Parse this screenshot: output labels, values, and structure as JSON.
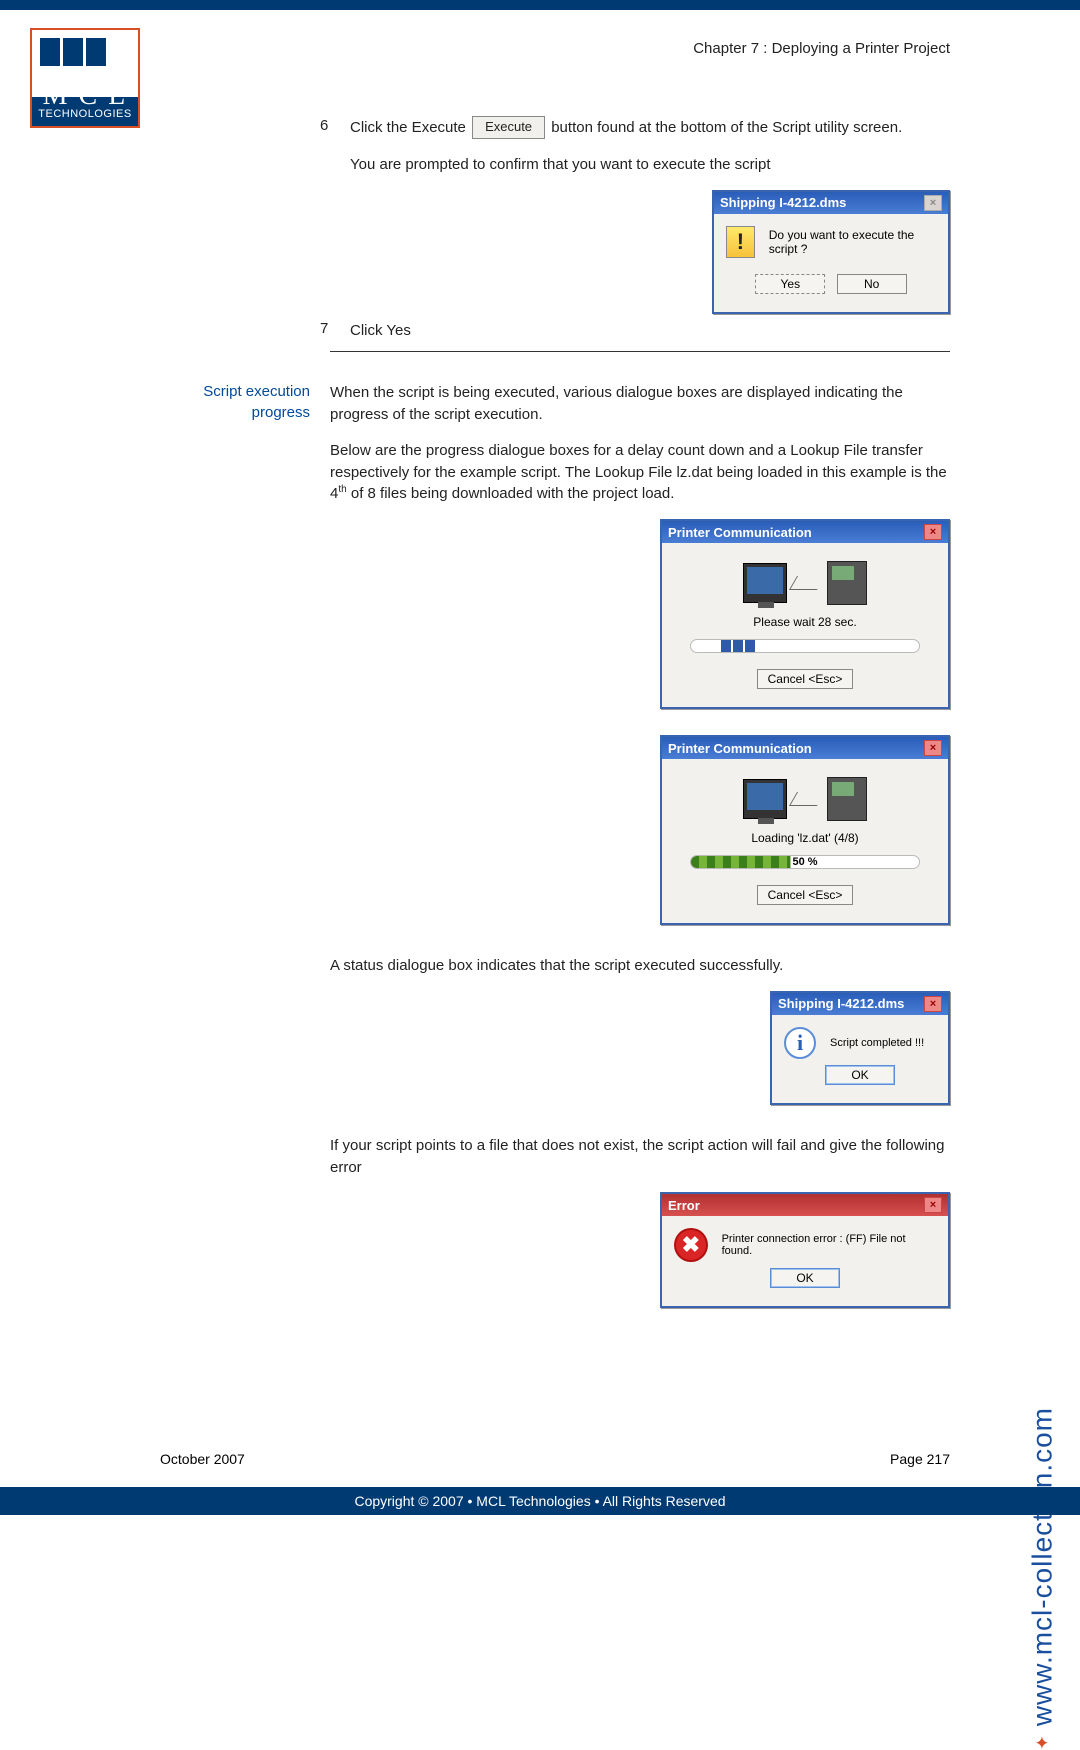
{
  "header": {
    "chapter": "Chapter 7 : Deploying a Printer Project"
  },
  "logo": {
    "top": "M C L",
    "bottom": "TECHNOLOGIES"
  },
  "steps": {
    "s6_num": "6",
    "s6_a": "Click the Execute",
    "s6_btn": "Execute",
    "s6_b": "button found at the bottom of the Script utility screen.",
    "s6_prompt": "You are prompted to confirm that you want to execute the script",
    "s7_num": "7",
    "s7_text": "Click Yes"
  },
  "confirm_dlg": {
    "title": "Shipping I-4212.dms",
    "message": "Do you want to execute the script ?",
    "yes": "Yes",
    "no": "No"
  },
  "section1": {
    "label_l1": "Script execution",
    "label_l2": "progress",
    "p1": "When the script is being executed, various dialogue boxes are displayed indicating the progress of the script execution.",
    "p2a": "Below are the progress dialogue boxes for a delay count down and a Lookup File transfer respectively for the example script. The Lookup File lz.dat being loaded in this example is the 4",
    "p2sup": "th",
    "p2b": " of 8 files being downloaded with the project load."
  },
  "progress_dlg1": {
    "title": "Printer Communication",
    "status": "Please wait 28 sec.",
    "cancel": "Cancel <Esc>"
  },
  "progress_dlg2": {
    "title": "Printer Communication",
    "status": "Loading 'lz.dat' (4/8)",
    "pct": "50 %",
    "cancel": "Cancel <Esc>"
  },
  "success": {
    "intro": "A status dialogue box indicates that the script executed successfully.",
    "title": "Shipping I-4212.dms",
    "msg": "Script completed !!!",
    "ok": "OK"
  },
  "error": {
    "intro": "If your script points to a file that does not exist, the script action will fail and give the following error",
    "title": "Error",
    "msg": "Printer connection error : (FF) File not found.",
    "ok": "OK"
  },
  "footer": {
    "date": "October 2007",
    "page": "Page 217",
    "url": "www.mcl-collection.com",
    "copyright": "Copyright © 2007 • MCL Technologies • All Rights Reserved"
  }
}
